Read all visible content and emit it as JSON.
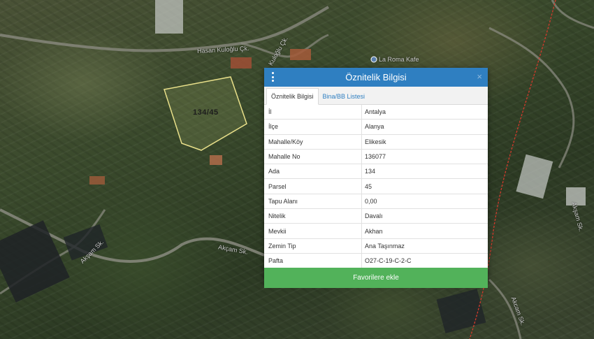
{
  "map": {
    "road_labels": [
      "Hasan Kuloğlu Çk.",
      "Kuloğlu Çk.",
      "Akçam Sk.",
      "Akşam Sk.",
      "Akşam Sk.",
      "Akcam Sk."
    ],
    "poi_label": "La Roma Kafe",
    "parcel_label": "134/45",
    "colors": {
      "parcel_outline": "#e9e08a",
      "boundary": "#d33a2c"
    }
  },
  "panel": {
    "title": "Öznitelik Bilgisi",
    "close_glyph": "×",
    "tabs": [
      {
        "label": "Öznitelik Bilgisi",
        "active": true
      },
      {
        "label": "Bina/BB Listesi",
        "active": false
      }
    ],
    "rows": [
      {
        "key": "İl",
        "value": "Antalya"
      },
      {
        "key": "İlçe",
        "value": "Alanya"
      },
      {
        "key": "Mahalle/Köy",
        "value": "Elikesik"
      },
      {
        "key": "Mahalle No",
        "value": "136077"
      },
      {
        "key": "Ada",
        "value": "134"
      },
      {
        "key": "Parsel",
        "value": "45"
      },
      {
        "key": "Tapu Alanı",
        "value": "0,00"
      },
      {
        "key": "Nitelik",
        "value": "Davalı"
      },
      {
        "key": "Mevkii",
        "value": "Akhan"
      },
      {
        "key": "Zemin Tip",
        "value": "Ana Taşınmaz"
      },
      {
        "key": "Pafta",
        "value": "O27-C-19-C-2-C"
      }
    ],
    "favorite_label": "Favorilere ekle",
    "colors": {
      "header": "#2f7fc1",
      "favorite": "#52b25a"
    }
  }
}
